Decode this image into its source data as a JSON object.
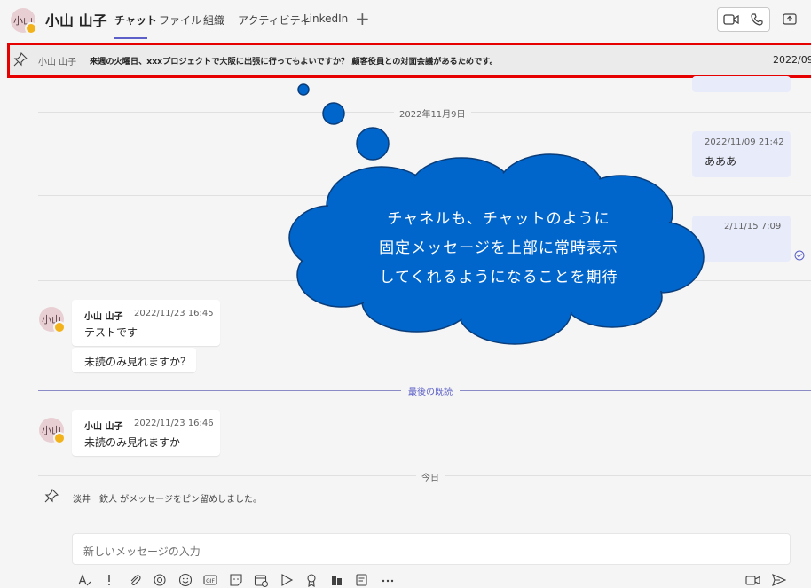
{
  "header": {
    "avatar_initials": "小山",
    "name": "小山 山子",
    "tabs": [
      {
        "label": "チャット",
        "active": true
      },
      {
        "label": "ファイル"
      },
      {
        "label": "組織"
      },
      {
        "label": "アクティビティ"
      },
      {
        "label": "LinkedIn"
      }
    ],
    "add_tab": "+"
  },
  "pinned": {
    "sender": "小山 山子",
    "text": "来週の火曜日、xxxプロジェクトで大阪に出張に行ってもよいですか？ 顧客役員との対面会議があるためです。",
    "date": "2022/09/"
  },
  "date_separators": [
    "2022年11月9日",
    "今日"
  ],
  "messages_right": [
    {
      "time": "2022/11/09 21:42",
      "body": "あああ"
    },
    {
      "time": "2/11/15 7:09"
    }
  ],
  "messages_left": [
    {
      "sender": "小山 山子",
      "time": "2022/11/23 16:45",
      "body": "テストです"
    },
    {
      "body": "未読のみ見れますか？"
    },
    {
      "sender": "小山 山子",
      "time": "2022/11/23 16:46",
      "body": "未読のみ見れますか"
    }
  ],
  "last_read_label": "最後の既読",
  "system_message": "淡井　欽人 がメッセージをピン留めしました。",
  "compose": {
    "placeholder": "新しいメッセージの入力"
  },
  "annotation": {
    "lines": [
      "チャネルも、チャットのように",
      "固定メッセージを上部に常時表示",
      "してくれるようになることを期待"
    ]
  },
  "colors": {
    "accent": "#5b5fc7",
    "highlight_border": "#e60000",
    "cloud": "#0066cc",
    "bubble_self": "#e8ebfa"
  }
}
